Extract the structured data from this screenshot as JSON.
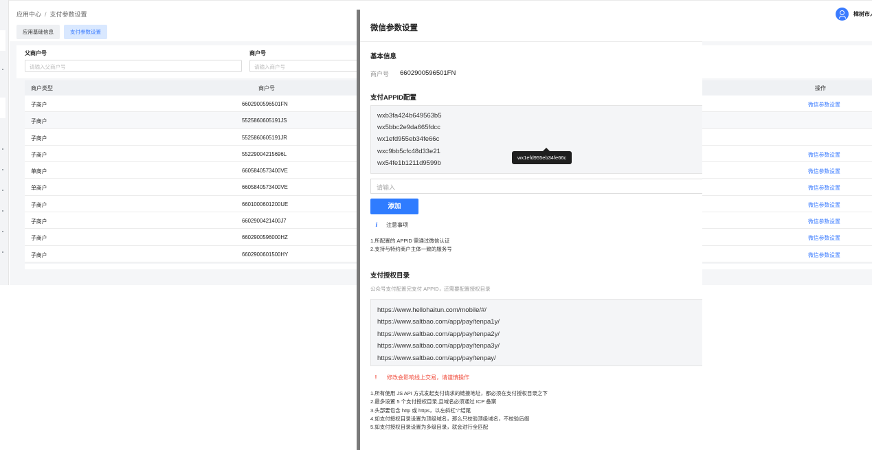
{
  "breadcrumb": {
    "root": "应用中心",
    "separator": "/",
    "current": "支付参数设置"
  },
  "tabs": [
    {
      "label": "应用基础信息",
      "active": false
    },
    {
      "label": "支付参数设置",
      "active": true
    }
  ],
  "filters": {
    "parent_label": "父商户号",
    "parent_placeholder": "请输入父商户号",
    "merchant_label": "商户号",
    "merchant_placeholder": "请输入商户号"
  },
  "table": {
    "headers": {
      "type": "商户类型",
      "no": "商户号",
      "op": "操作"
    },
    "rows": [
      {
        "type": "子商户",
        "no": "6602900596501FN",
        "op": "微信参数设置"
      },
      {
        "type": "子商户",
        "no": "5525860605191JS",
        "op": ""
      },
      {
        "type": "子商户",
        "no": "5525860605191JR",
        "op": ""
      },
      {
        "type": "子商户",
        "no": "55229004215696L",
        "op": "微信参数设置"
      },
      {
        "type": "单商户",
        "no": "6605840573400VE",
        "op": "微信参数设置"
      },
      {
        "type": "单商户",
        "no": "6605840573400VE",
        "op": "微信参数设置"
      },
      {
        "type": "子商户",
        "no": "6601000601200UE",
        "op": "微信参数设置"
      },
      {
        "type": "子商户",
        "no": "6602900421400J7",
        "op": "微信参数设置"
      },
      {
        "type": "子商户",
        "no": "6602900596000HZ",
        "op": "微信参数设置"
      },
      {
        "type": "子商户",
        "no": "6602900601500HY",
        "op": "微信参数设置"
      }
    ]
  },
  "user": {
    "name": "樟树市人",
    "avatar_icon": "user-icon"
  },
  "drawer": {
    "title": "微信参数设置",
    "basic_title": "基本信息",
    "merchant_label": "商户号",
    "merchant_value": "6602900596501FN",
    "appid_title": "支付APPID配置",
    "appids": [
      "wxb3fa424b649563b5",
      "wx5bbc2e9da665fdcc",
      "wx1efd955eb34fe66c",
      "wxc9bb5cfc48d33e21",
      "wx54fe1b1211d9599b"
    ],
    "tooltip": "wx1efd955eb34fe66c",
    "input_placeholder": "请输入",
    "add_button": "添加",
    "notice_icon": "i",
    "notice_title": "注意事项",
    "notice_lines": [
      "1.所配置的 APPID 需通过微信认证",
      "2.支持与特约商户主体一致的服务号"
    ],
    "auth_title": "支付授权目录",
    "auth_desc": "公众号支付配置完支付 APPID，还需要配置授权目录",
    "domains": [
      "https://www.hellohaitun.com/mobile/#/",
      "https://www.saltbao.com/app/pay/tenpa1y/",
      "https://www.saltbao.com/app/pay/tenpa2y/",
      "https://www.saltbao.com/app/pay/tenpa3y/",
      "https://www.saltbao.com/app/pay/tenpay/"
    ],
    "warn_icon": "!",
    "warning": "修改会影响线上交易，请谨慎操作",
    "rules": [
      "1.所有使用 JS API 方式发起支付请求的链接地址，都必须在支付授权目录之下",
      "2.最多设置 5 个支付授权目录,且域名必须通过 ICP 备案",
      "3.头部要包含 http 或 https，以左斜杠\"/\"结尾",
      "4.如支付授权目录设置为顶级域名，那么只校验顶级域名，不校验后缀",
      "5.如支付授权目录设置为多级目录，就会进行全匹配"
    ]
  }
}
